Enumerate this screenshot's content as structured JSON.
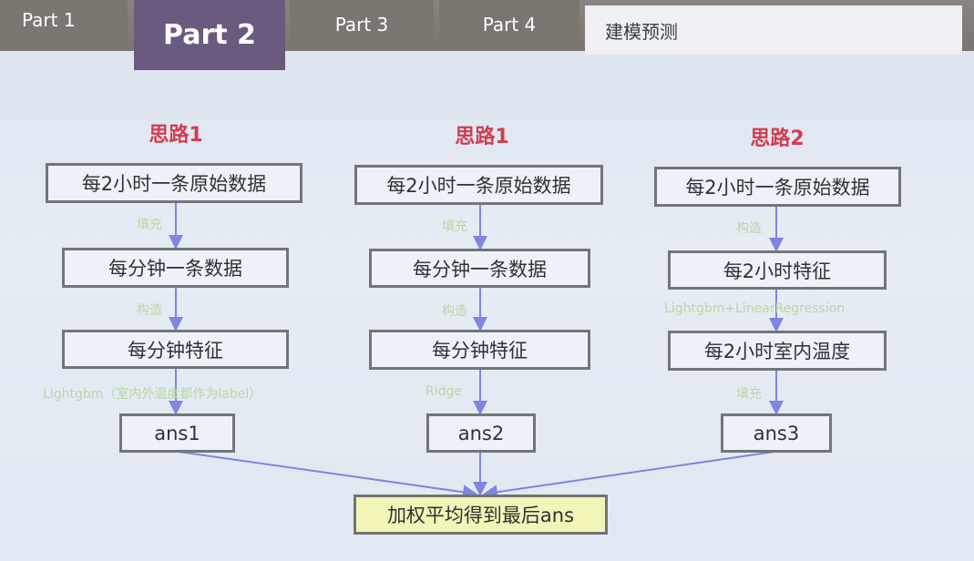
{
  "tabs": [
    "Part 1",
    "Part 2",
    "Part 3",
    "Part 4",
    "建模预测"
  ],
  "columns": [
    {
      "heading": "思路1",
      "boxes": [
        "每2小时一条原始数据",
        "每分钟一条数据",
        "每分钟特征",
        "ans1"
      ],
      "labels": [
        "填充",
        "构造",
        "Lightgbm（室内外温度都作为label）"
      ]
    },
    {
      "heading": "思路1",
      "boxes": [
        "每2小时一条原始数据",
        "每分钟一条数据",
        "每分钟特征",
        "ans2"
      ],
      "labels": [
        "填充",
        "构造",
        "Ridge"
      ]
    },
    {
      "heading": "思路2",
      "boxes": [
        "每2小时一条原始数据",
        "每2小时特征",
        "每2小时室内温度",
        "ans3"
      ],
      "labels": [
        "构造",
        "Lightgbm+LinearRegression",
        "填充"
      ]
    }
  ],
  "final_box": "加权平均得到最后ans"
}
